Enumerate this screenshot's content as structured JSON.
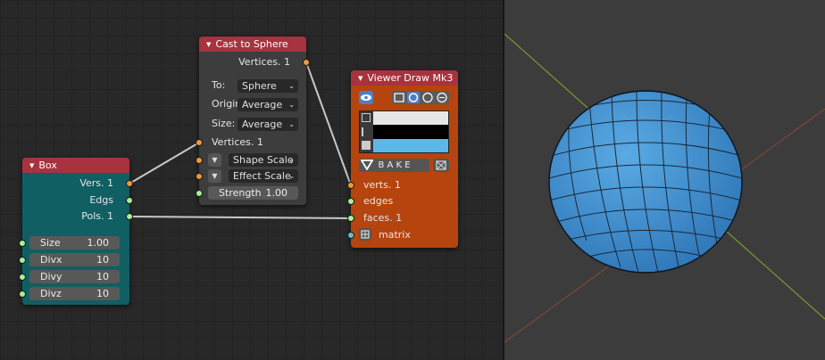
{
  "box_node": {
    "title": "Box",
    "outputs": [
      "Vers. 1",
      "Edgs",
      "Pols. 1"
    ],
    "params": [
      {
        "label": "Size",
        "value": "1.00"
      },
      {
        "label": "Divx",
        "value": "10"
      },
      {
        "label": "Divy",
        "value": "10"
      },
      {
        "label": "Divz",
        "value": "10"
      }
    ]
  },
  "cast_node": {
    "title": "Cast to Sphere",
    "output": "Vertices. 1",
    "to_label": "To:",
    "to_value": "Sphere",
    "origin_label": "Origin",
    "origin_value": "Average",
    "size_label": "Size:",
    "size_value": "Average",
    "input_vertices": "Vertices. 1",
    "shape_scale": "Shape Scale",
    "effect_scale": "Effect Scale",
    "strength_label": "Strength",
    "strength_value": "1.00"
  },
  "viewer_node": {
    "title": "Viewer Draw Mk3",
    "bake_label": "B A K E",
    "inputs": [
      "verts. 1",
      "edges",
      "faces. 1",
      "matrix"
    ],
    "colors": {
      "vertex": "#e6e6e6",
      "edge": "#000000",
      "face": "#5cb8e8"
    }
  },
  "colors": {
    "header": "#a8323e",
    "box_body": "#0f5f63",
    "viewer_body": "#b5440e",
    "socket_vertices": "#ee9a3a",
    "socket_float": "#a5f29b",
    "socket_matrix": "#5fc1cf",
    "sphere": "#3d8ccb"
  }
}
